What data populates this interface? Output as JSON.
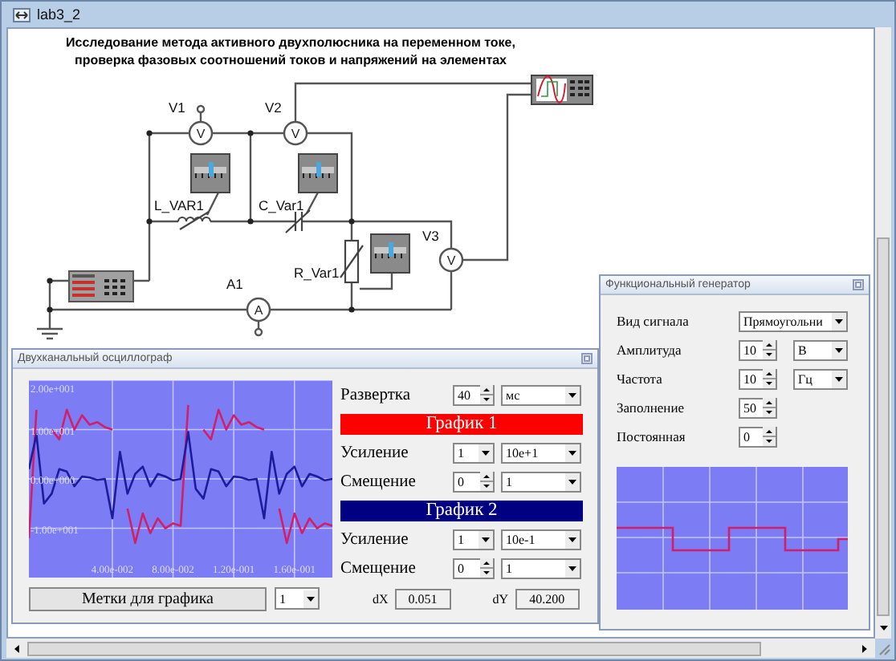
{
  "window": {
    "title": "lab3_2"
  },
  "circuit": {
    "heading": [
      "Исследование метода активного двухполюсника на переменном токе,",
      "проверка фазовых соотношений токов и напряжений на элементах"
    ],
    "meters": [
      {
        "label": "V1",
        "symbol": "V"
      },
      {
        "label": "V2",
        "symbol": "V"
      },
      {
        "label": "V3",
        "symbol": "V"
      },
      {
        "label": "A1",
        "symbol": "A"
      }
    ],
    "elements": [
      {
        "label": "L_VAR1",
        "kind": "inductor"
      },
      {
        "label": "C_Var1",
        "kind": "capacitor"
      },
      {
        "label": "R_Var1",
        "kind": "resistor"
      }
    ]
  },
  "oscilloscope": {
    "title": "Двухканальный осциллограф",
    "chart_data": {
      "type": "line",
      "x": [
        -0.015,
        -0.01,
        -0.005,
        0,
        0.005,
        0.01,
        0.015,
        0.02,
        0.025,
        0.03,
        0.035,
        0.04,
        0.045,
        0.05,
        0.055,
        0.06,
        0.065,
        0.07,
        0.075,
        0.08,
        0.085,
        0.09,
        0.095,
        0.1,
        0.105,
        0.11,
        0.115,
        0.12,
        0.125,
        0.13,
        0.135,
        0.14,
        0.145,
        0.15,
        0.155,
        0.16,
        0.165,
        0.17,
        0.175,
        0.18,
        0.185
      ],
      "series": [
        {
          "color": "#d0206a",
          "values": [
            -12,
            14,
            null,
            10,
            8,
            14,
            10,
            12.9,
            11,
            11.5,
            10.5,
            10,
            null,
            -6,
            -13,
            -7,
            -11,
            -8,
            -10,
            -9,
            -9.5,
            15,
            null,
            10,
            8,
            14,
            10,
            12.9,
            11,
            11.5,
            10.5,
            10,
            null,
            -6,
            -13,
            -7,
            -11,
            -8,
            -10,
            -9,
            -9.5
          ]
        },
        {
          "color": "#1c1c9c",
          "values": [
            2,
            9,
            -5,
            -3,
            2,
            1.5,
            -1.5,
            0.5,
            0.3,
            -0.2,
            0,
            -8,
            5.5,
            -3,
            1,
            2.5,
            -1.5,
            1,
            0.5,
            -0.3,
            0,
            9.5,
            -2,
            -4,
            2,
            1.5,
            -1.5,
            0.5,
            0.3,
            -0.2,
            0,
            -8,
            5.5,
            -3,
            1,
            2.5,
            -1.5,
            1,
            0.5,
            -0.3,
            0
          ]
        }
      ],
      "xlim": [
        -0.015,
        0.185
      ],
      "ylim": [
        -20,
        20
      ],
      "grid": true,
      "xticks": [
        {
          "value": 0.04,
          "label": "4.00e-002"
        },
        {
          "value": 0.08,
          "label": "8.00e-002"
        },
        {
          "value": 0.12,
          "label": "1.20e-001"
        },
        {
          "value": 0.16,
          "label": "1.60e-001"
        }
      ],
      "yticks": [
        {
          "value": 20,
          "label": "2.00e+001"
        },
        {
          "value": 10,
          "label": "1.00e+001"
        },
        {
          "value": 0,
          "label": "0.00e+000"
        },
        {
          "value": -10,
          "label": "-1.00e+001"
        }
      ]
    },
    "controls": [
      {
        "kind": "spin",
        "label": "Развертка",
        "value": "40",
        "unit": "мс"
      },
      {
        "kind": "header",
        "label": "График 1",
        "color": "#ff0000"
      },
      {
        "kind": "select",
        "label": "Усиление",
        "value": "1",
        "unit": "10e+1"
      },
      {
        "kind": "spin",
        "label": "Смещение",
        "value": "0",
        "unit": "1"
      },
      {
        "kind": "header",
        "label": "График 2",
        "color": "#000080"
      },
      {
        "kind": "select",
        "label": "Усиление",
        "value": "1",
        "unit": "10e-1"
      },
      {
        "kind": "spin",
        "label": "Смещение",
        "value": "0",
        "unit": "1"
      }
    ],
    "marks_button": "Метки для графика",
    "marks_select": "1",
    "readouts": [
      {
        "label": "dX",
        "value": "0.051"
      },
      {
        "label": "dY",
        "value": "40.200"
      }
    ]
  },
  "generator": {
    "title": "Функциональный генератор",
    "controls": [
      {
        "kind": "select",
        "label": "Вид сигнала",
        "value": "Прямоугольни"
      },
      {
        "kind": "spin",
        "label": "Амплитуда",
        "value": "10",
        "unit": "В"
      },
      {
        "kind": "spin",
        "label": "Частота",
        "value": "10",
        "unit": "Гц"
      },
      {
        "kind": "spin",
        "label": "Заполнение",
        "value": "50"
      },
      {
        "kind": "spin",
        "label": "Постоянная",
        "value": "0"
      }
    ]
  }
}
